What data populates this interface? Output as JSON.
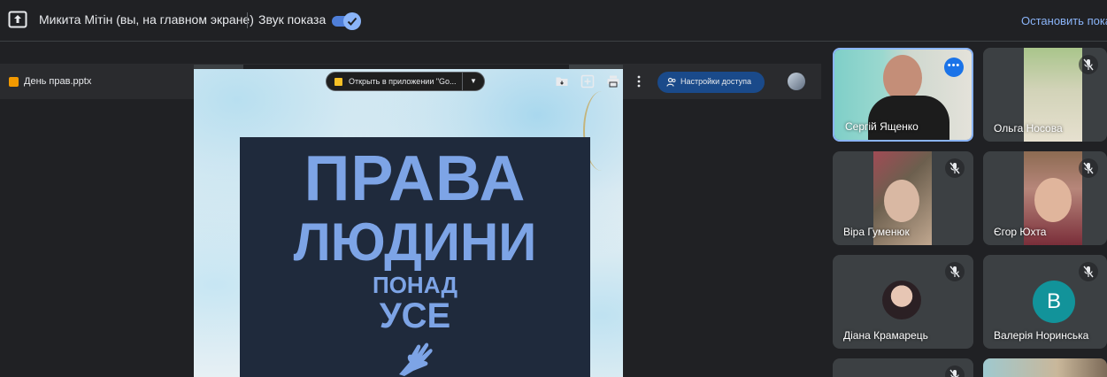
{
  "banner": {
    "presenter_text": "Микита Мітін (вы, на главном экране)",
    "sound_label": "Звук показа",
    "sound_enabled": true,
    "stop_label": "Остановить показ",
    "icons": {
      "present": "present-to-all-icon",
      "toggle_check": "check-icon"
    }
  },
  "docs_toolbar": {
    "file_name": "День прав.pptx",
    "open_in_app_label": "Открыть в приложении \"Go...",
    "share_settings_label": "Настройки доступа",
    "icons": [
      "file-pptx-icon",
      "move-to-folder-icon",
      "add-to-drive-icon",
      "print-icon",
      "more-vert-icon",
      "people-icon",
      "account-avatar"
    ]
  },
  "slide": {
    "line1": "ПРАВА",
    "line2": "ЛЮДИНИ",
    "line3": "ПОНАД",
    "line4": "УСЕ",
    "accent_color": "#7da4e6",
    "poster_color": "#1f2a3c"
  },
  "participants": [
    {
      "name": "Сергій Ященко",
      "muted": false,
      "active": true
    },
    {
      "name": "Ольга Носова",
      "muted": true
    },
    {
      "name": "Віра Гуменюк",
      "muted": true
    },
    {
      "name": "Єгор Юхта",
      "muted": true
    },
    {
      "name": "Діана Крамарець",
      "muted": true
    },
    {
      "name": "Валерія Норинська",
      "muted": true,
      "initial": "В"
    },
    {
      "name": "",
      "muted": true
    },
    {
      "name": "",
      "muted": true
    }
  ],
  "colors": {
    "background": "#202124",
    "tile": "#3c4043",
    "accent_blue": "#8ab4f8",
    "share_button": "#1a4a8a"
  }
}
